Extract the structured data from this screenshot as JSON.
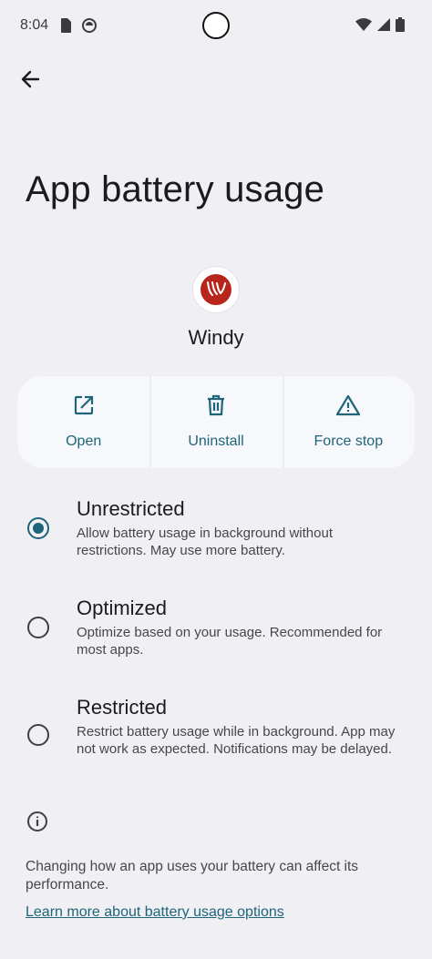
{
  "status_bar": {
    "time": "8:04",
    "left_icons": [
      "sim-card-icon",
      "vpn-icon"
    ],
    "right_icons": [
      "wifi-icon",
      "cell-signal-icon",
      "battery-icon"
    ]
  },
  "header": {
    "back_icon": "arrow-back-icon",
    "title": "App battery usage"
  },
  "app": {
    "name": "Windy",
    "icon_color": "#b8251c"
  },
  "actions": [
    {
      "label": "Open",
      "icon": "open-external-icon"
    },
    {
      "label": "Uninstall",
      "icon": "trash-icon"
    },
    {
      "label": "Force stop",
      "icon": "warning-icon"
    }
  ],
  "options": [
    {
      "title": "Unrestricted",
      "description": "Allow battery usage in background without restrictions. May use more battery.",
      "selected": true
    },
    {
      "title": "Optimized",
      "description": "Optimize based on your usage. Recommended for most apps.",
      "selected": false
    },
    {
      "title": "Restricted",
      "description": "Restrict battery usage while in background. App may not work as expected. Notifications may be delayed.",
      "selected": false
    }
  ],
  "footer": {
    "info_icon": "info-icon",
    "text": "Changing how an app uses your battery can affect its performance.",
    "link": "Learn more about battery usage options"
  },
  "colors": {
    "accent": "#1e6579",
    "background": "#f0eff4",
    "card": "#f7f8fb"
  }
}
